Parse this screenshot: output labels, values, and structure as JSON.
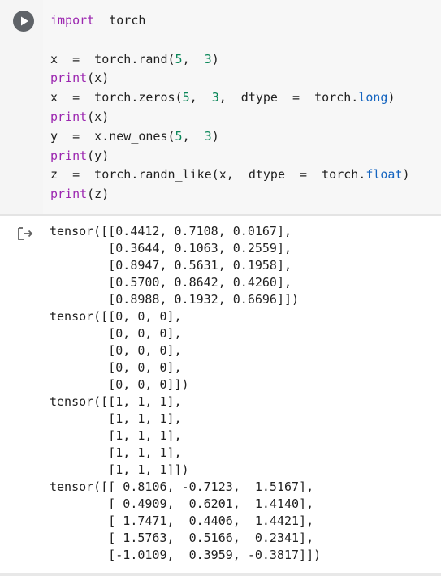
{
  "cell": {
    "run_button_label": "run-cell",
    "icons": {
      "run": "play-icon",
      "output": "output-arrow-icon"
    },
    "colors": {
      "keyword": "#9c27b0",
      "number": "#098658",
      "attribute": "#1565c0",
      "text": "#212121",
      "gutter": "#f5f5f5",
      "editor_bg": "#f7f7f7"
    },
    "code_lines": [
      [
        {
          "t": "import",
          "c": "kw"
        },
        {
          "t": "  torch",
          "c": ""
        }
      ],
      [
        {
          "t": "",
          "c": ""
        }
      ],
      [
        {
          "t": "x  =  torch.rand(",
          "c": ""
        },
        {
          "t": "5",
          "c": "num"
        },
        {
          "t": ",  ",
          "c": ""
        },
        {
          "t": "3",
          "c": "num"
        },
        {
          "t": ")",
          "c": ""
        }
      ],
      [
        {
          "t": "print",
          "c": "kw"
        },
        {
          "t": "(x)",
          "c": ""
        }
      ],
      [
        {
          "t": "x  =  torch.zeros(",
          "c": ""
        },
        {
          "t": "5",
          "c": "num"
        },
        {
          "t": ",  ",
          "c": ""
        },
        {
          "t": "3",
          "c": "num"
        },
        {
          "t": ",  dtype  =  torch.",
          "c": ""
        },
        {
          "t": "long",
          "c": "attr"
        },
        {
          "t": ")",
          "c": ""
        }
      ],
      [
        {
          "t": "print",
          "c": "kw"
        },
        {
          "t": "(x)",
          "c": ""
        }
      ],
      [
        {
          "t": "y  =  x.new_ones(",
          "c": ""
        },
        {
          "t": "5",
          "c": "num"
        },
        {
          "t": ",  ",
          "c": ""
        },
        {
          "t": "3",
          "c": "num"
        },
        {
          "t": ")",
          "c": ""
        }
      ],
      [
        {
          "t": "print",
          "c": "kw"
        },
        {
          "t": "(y)",
          "c": ""
        }
      ],
      [
        {
          "t": "z  =  torch.randn_like(x,  dtype  =  torch.",
          "c": ""
        },
        {
          "t": "float",
          "c": "attr"
        },
        {
          "t": ")",
          "c": ""
        }
      ],
      [
        {
          "t": "print",
          "c": "kw"
        },
        {
          "t": "(z)",
          "c": ""
        }
      ]
    ],
    "output_lines": [
      "tensor([[0.4412, 0.7108, 0.0167],",
      "        [0.3644, 0.1063, 0.2559],",
      "        [0.8947, 0.5631, 0.1958],",
      "        [0.5700, 0.8642, 0.4260],",
      "        [0.8988, 0.1932, 0.6696]])",
      "tensor([[0, 0, 0],",
      "        [0, 0, 0],",
      "        [0, 0, 0],",
      "        [0, 0, 0],",
      "        [0, 0, 0]])",
      "tensor([[1, 1, 1],",
      "        [1, 1, 1],",
      "        [1, 1, 1],",
      "        [1, 1, 1],",
      "        [1, 1, 1]])",
      "tensor([[ 0.8106, -0.7123,  1.5167],",
      "        [ 0.4909,  0.6201,  1.4140],",
      "        [ 1.7471,  0.4406,  1.4421],",
      "        [ 1.5763,  0.5166,  0.2341],",
      "        [-1.0109,  0.3959, -0.3817]])"
    ]
  }
}
